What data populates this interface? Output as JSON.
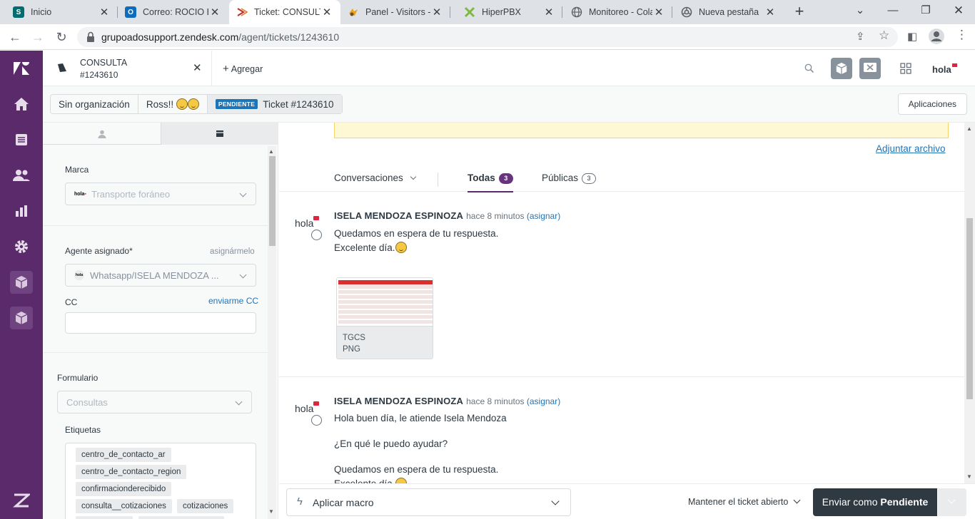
{
  "browser": {
    "tabs": [
      {
        "title": "Inicio",
        "icon": "sharepoint-icon",
        "color": "#036c70"
      },
      {
        "title": "Correo: ROCIO EN",
        "icon": "outlook-icon",
        "color": "#0f6cbd"
      },
      {
        "title": "Ticket: CONSULTA",
        "icon": "zendesk-icon",
        "color": "#c6302b"
      },
      {
        "title": "Panel - Visitors -",
        "icon": "visitors-icon",
        "color": "#e8a317"
      },
      {
        "title": "HiperPBX",
        "icon": "hiperpbx-icon",
        "color": "#7db93c"
      },
      {
        "title": "Monitoreo - Cola",
        "icon": "globe-icon",
        "color": "#5f6368"
      },
      {
        "title": "Nueva pestaña",
        "icon": "chrome-icon",
        "color": "#5f6368"
      }
    ],
    "url_host": "grupoadosupport.zendesk.com",
    "url_path": "/agent/tickets/1243610"
  },
  "header": {
    "ticket_tab_title": "CONSULTA",
    "ticket_tab_id": "#1243610",
    "add_label": "Agregar",
    "brand_label": "hola"
  },
  "breadcrumb": {
    "organization": "Sin organización",
    "requester": "Ross!!",
    "status": "PENDIENTE",
    "ticket": "Ticket #1243610",
    "apps_button": "Aplicaciones"
  },
  "properties": {
    "brand_label": "Marca",
    "brand_value": "Transporte foráneo",
    "assignee_label": "Agente asignado*",
    "assign_me": "asignármelo",
    "assignee_value": "Whatsapp/ISELA MENDOZA ...",
    "cc_label": "CC",
    "cc_me": "enviarme CC",
    "form_label": "Formulario",
    "form_value": "Consultas",
    "tags_label": "Etiquetas",
    "tags": [
      "centro_de_contacto_ar",
      "centro_de_contacto_region",
      "confirmacionderecibido",
      "consulta__cotizaciones",
      "cotizaciones"
    ]
  },
  "conversation": {
    "attach_link": "Adjuntar archivo",
    "filter_label": "Conversaciones",
    "tabs": [
      {
        "label": "Todas",
        "count": "3"
      },
      {
        "label": "Públicas",
        "count": "3"
      }
    ],
    "messages": [
      {
        "avatar": "hola",
        "author": "ISELA MENDOZA ESPINOZA",
        "time": "hace 8 minutos",
        "assign": "(asignar)",
        "lines": [
          "Quedamos en espera de tu respuesta.",
          "Excelente día."
        ],
        "attachment": {
          "name": "TGCS",
          "type": "PNG"
        }
      },
      {
        "avatar": "hola",
        "author": "ISELA MENDOZA ESPINOZA",
        "time": "hace 8 minutos",
        "assign": "(asignar)",
        "lines": [
          "Hola buen día, le atiende Isela Mendoza",
          "¿En qué le puedo ayudar?",
          "Quedamos en espera de tu respuesta.",
          "Excelente día."
        ]
      }
    ]
  },
  "footer": {
    "macro_label": "Aplicar macro",
    "keep_open": "Mantener el ticket abierto",
    "submit_prefix": "Enviar como ",
    "submit_status": "Pendiente"
  },
  "colors": {
    "nav_bg": "#5a2a6a",
    "accent_link": "#1f73b7",
    "submit_bg": "#2f3941",
    "pending_badge": "#1f73b7"
  }
}
